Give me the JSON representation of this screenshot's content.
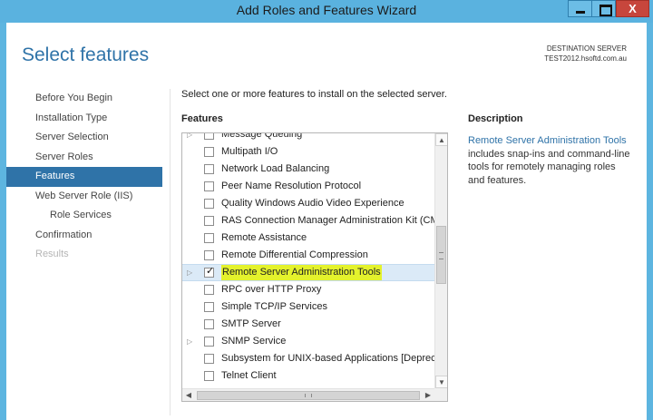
{
  "window": {
    "title": "Add Roles and Features Wizard",
    "close_glyph": "X"
  },
  "page": {
    "title": "Select features",
    "destination_label": "DESTINATION SERVER",
    "destination_server": "TEST2012.hsoftd.com.au",
    "instruction": "Select one or more features to install on the selected server."
  },
  "nav": {
    "items": [
      {
        "label": "Before You Begin"
      },
      {
        "label": "Installation Type"
      },
      {
        "label": "Server Selection"
      },
      {
        "label": "Server Roles"
      },
      {
        "label": "Features"
      },
      {
        "label": "Web Server Role (IIS)"
      },
      {
        "label": "Role Services"
      },
      {
        "label": "Confirmation"
      },
      {
        "label": "Results"
      }
    ],
    "active": "Features"
  },
  "features": {
    "label": "Features",
    "items": [
      {
        "label": "Message Queuing",
        "checked": false,
        "expandable": true
      },
      {
        "label": "Multipath I/O",
        "checked": false
      },
      {
        "label": "Network Load Balancing",
        "checked": false
      },
      {
        "label": "Peer Name Resolution Protocol",
        "checked": false
      },
      {
        "label": "Quality Windows Audio Video Experience",
        "checked": false
      },
      {
        "label": "RAS Connection Manager Administration Kit (CMA",
        "checked": false
      },
      {
        "label": "Remote Assistance",
        "checked": false
      },
      {
        "label": "Remote Differential Compression",
        "checked": false
      },
      {
        "label": "Remote Server Administration Tools",
        "checked": true,
        "expandable": true,
        "selected": true
      },
      {
        "label": "RPC over HTTP Proxy",
        "checked": false
      },
      {
        "label": "Simple TCP/IP Services",
        "checked": false
      },
      {
        "label": "SMTP Server",
        "checked": false
      },
      {
        "label": "SNMP Service",
        "checked": false,
        "expandable": true
      },
      {
        "label": "Subsystem for UNIX-based Applications [Deprecat",
        "checked": false
      },
      {
        "label": "Telnet Client",
        "checked": false
      }
    ]
  },
  "description": {
    "label": "Description",
    "link_text": "Remote Server Administration Tools",
    "text": "includes snap-ins and command-line tools for remotely managing roles and features."
  },
  "colors": {
    "accent": "#2f73a8",
    "titlebar": "#5ab2df",
    "highlight": "#e4f22c",
    "close_button": "#c7463c"
  }
}
